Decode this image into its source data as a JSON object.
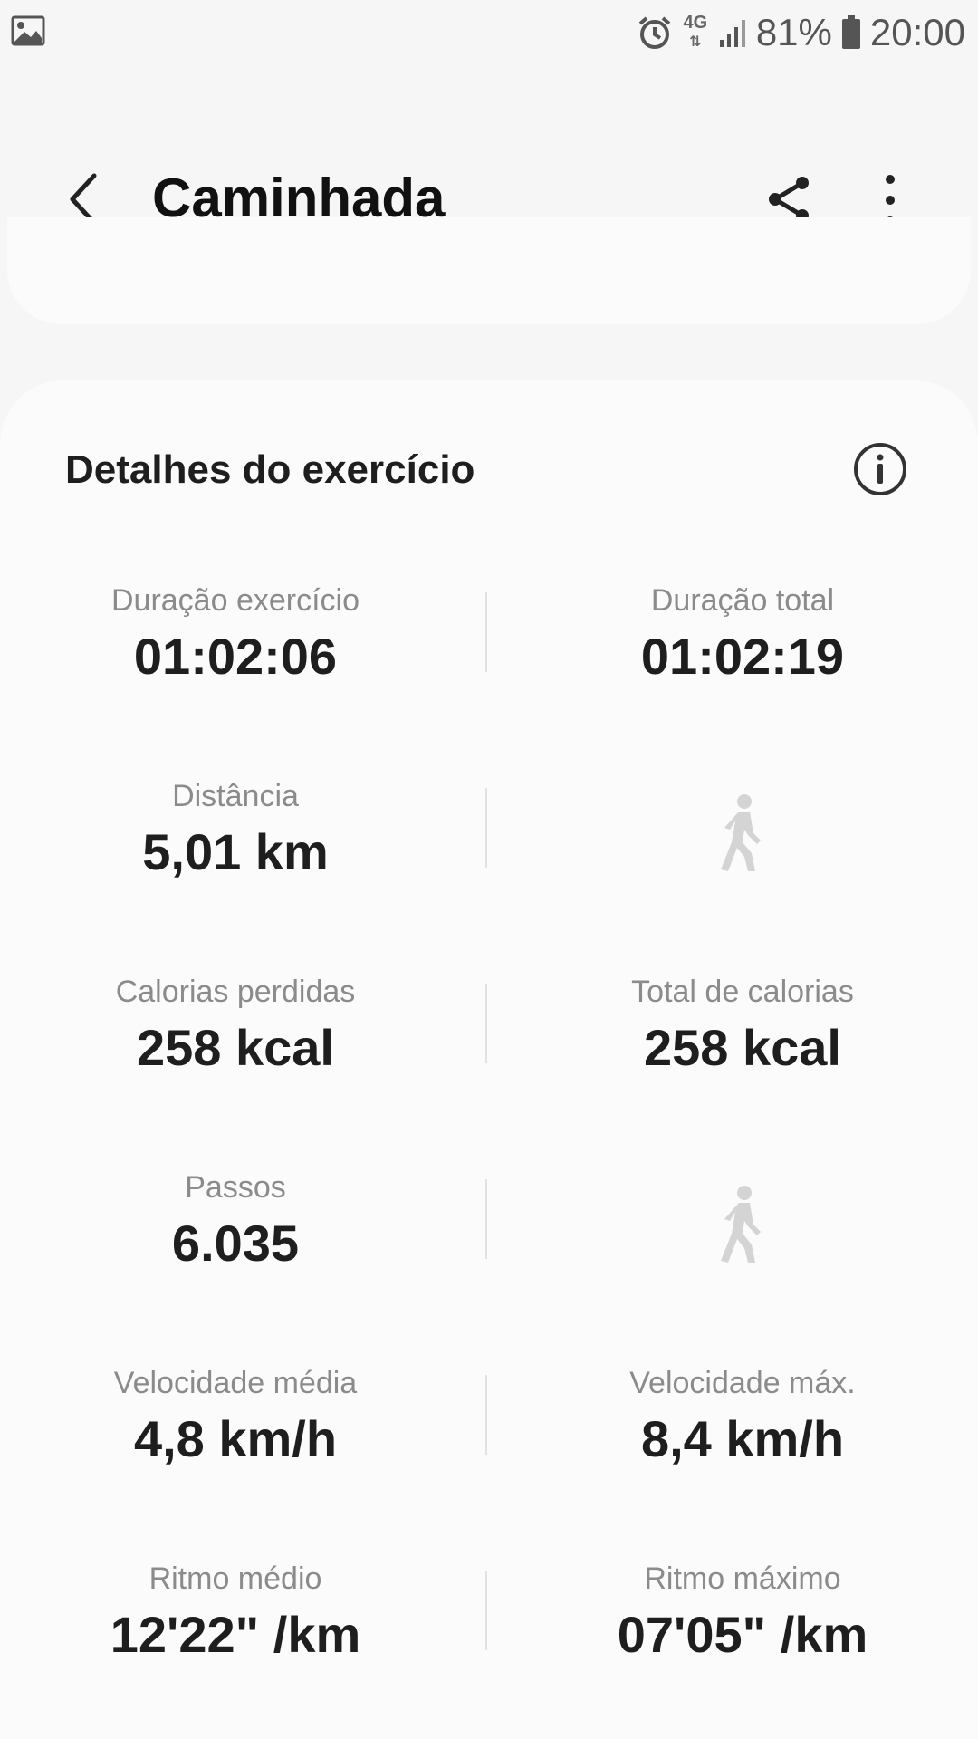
{
  "status_bar": {
    "battery_percent": "81%",
    "time": "20:00",
    "network": "4G",
    "icons": [
      "gallery-icon",
      "alarm-icon",
      "network-4g-icon",
      "signal-icon",
      "battery-icon"
    ]
  },
  "app_bar": {
    "title": "Caminhada",
    "icons": [
      "back-icon",
      "share-icon",
      "more-options-icon"
    ]
  },
  "details": {
    "title": "Detalhes do exercício",
    "rows": [
      {
        "left": {
          "label": "Duração exercício",
          "value": "01:02:06"
        },
        "right": {
          "label": "Duração total",
          "value": "01:02:19"
        }
      },
      {
        "left": {
          "label": "Distância",
          "value": "5,01 km"
        },
        "right": {
          "icon": "walking-person-icon"
        }
      },
      {
        "left": {
          "label": "Calorias perdidas",
          "value": "258 kcal"
        },
        "right": {
          "label": "Total de calorias",
          "value": "258 kcal"
        }
      },
      {
        "left": {
          "label": "Passos",
          "value": "6.035"
        },
        "right": {
          "icon": "walking-person-icon"
        }
      },
      {
        "left": {
          "label": "Velocidade média",
          "value": "4,8 km/h"
        },
        "right": {
          "label": "Velocidade máx.",
          "value": "8,4 km/h"
        }
      },
      {
        "left": {
          "label": "Ritmo médio",
          "value": "12'22\" /km"
        },
        "right": {
          "label": "Ritmo máximo",
          "value": "07'05\" /km"
        }
      }
    ]
  },
  "colors": {
    "background": "#f6f6f6",
    "card": "#fbfbfb",
    "label_gray": "#8b8b8b",
    "value_text": "#1e1e1e",
    "icon_light": "#d4d4d4"
  }
}
